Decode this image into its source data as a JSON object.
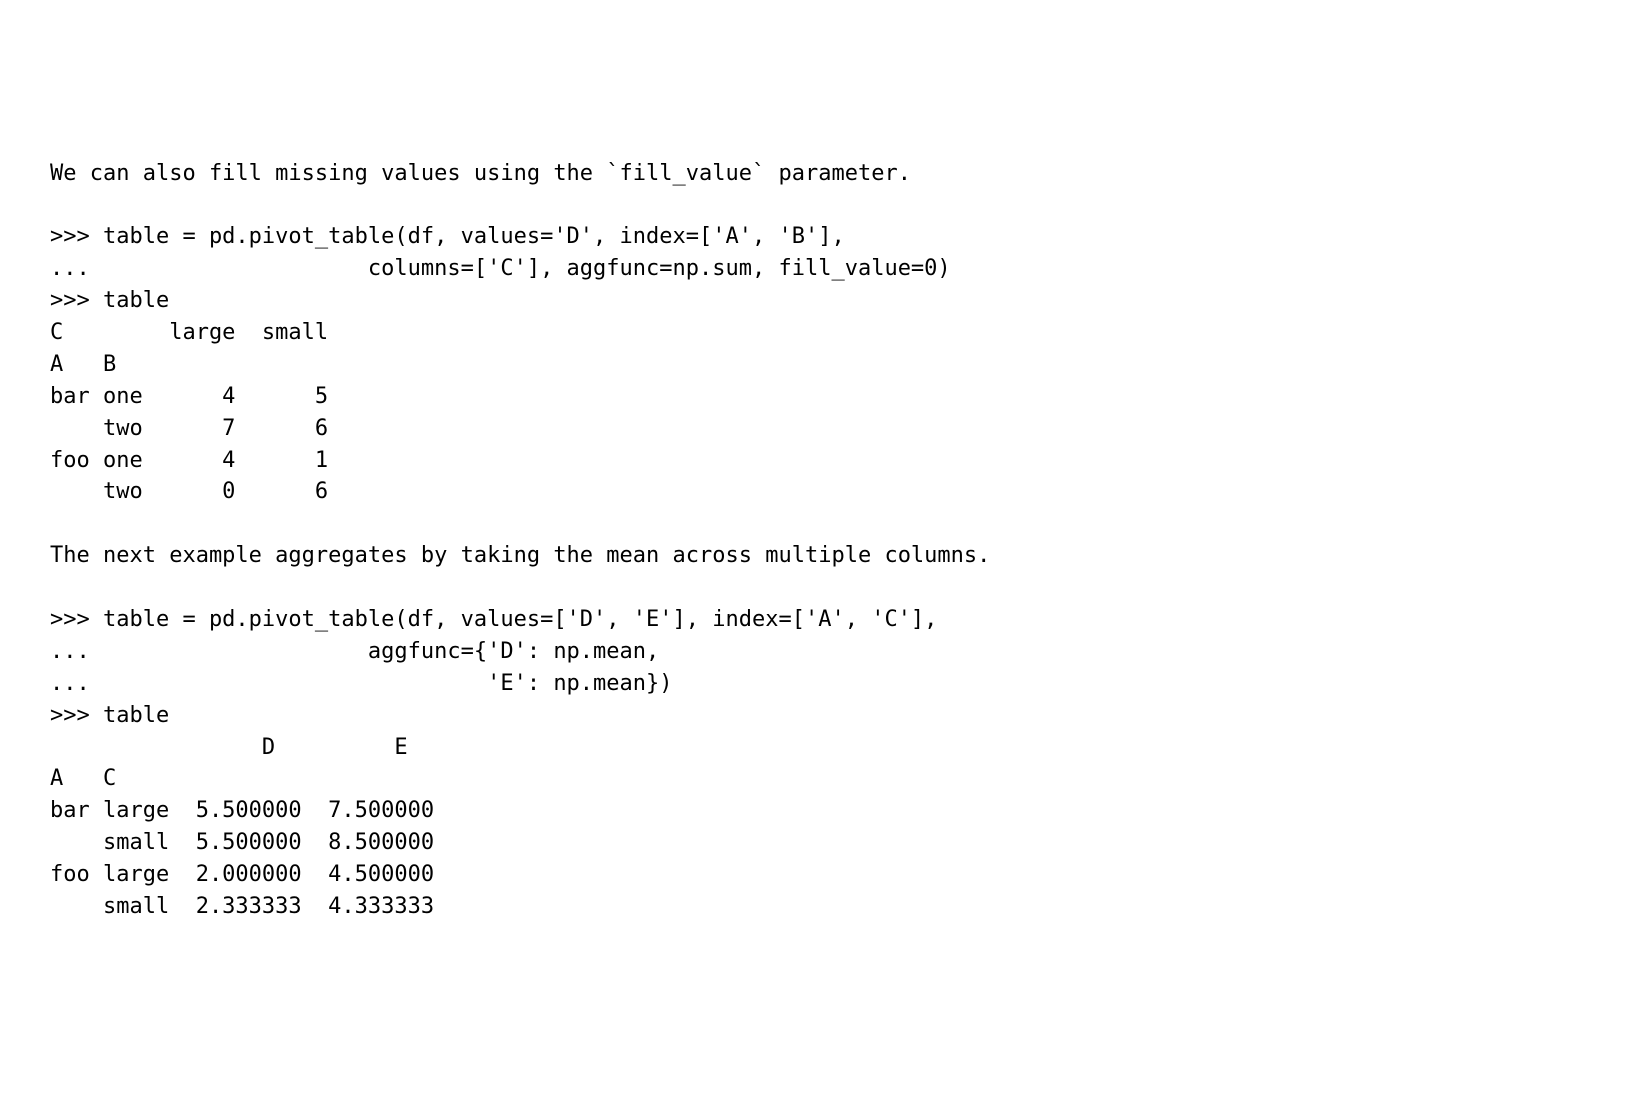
{
  "lines": {
    "l01": "We can also fill missing values using the `fill_value` parameter.",
    "l02": "",
    "l03": ">>> table = pd.pivot_table(df, values='D', index=['A', 'B'],",
    "l04": "...                     columns=['C'], aggfunc=np.sum, fill_value=0)",
    "l05": ">>> table",
    "l06": "C        large  small",
    "l07": "A   B",
    "l08": "bar one      4      5",
    "l09": "    two      7      6",
    "l10": "foo one      4      1",
    "l11": "    two      0      6",
    "l12": "",
    "l13": "The next example aggregates by taking the mean across multiple columns.",
    "l14": "",
    "l15": ">>> table = pd.pivot_table(df, values=['D', 'E'], index=['A', 'C'],",
    "l16": "...                     aggfunc={'D': np.mean,",
    "l17": "...                              'E': np.mean})",
    "l18": ">>> table",
    "l19": "                D         E",
    "l20": "A   C",
    "l21": "bar large  5.500000  7.500000",
    "l22": "    small  5.500000  8.500000",
    "l23": "foo large  2.000000  4.500000",
    "l24": "    small  2.333333  4.333333"
  }
}
